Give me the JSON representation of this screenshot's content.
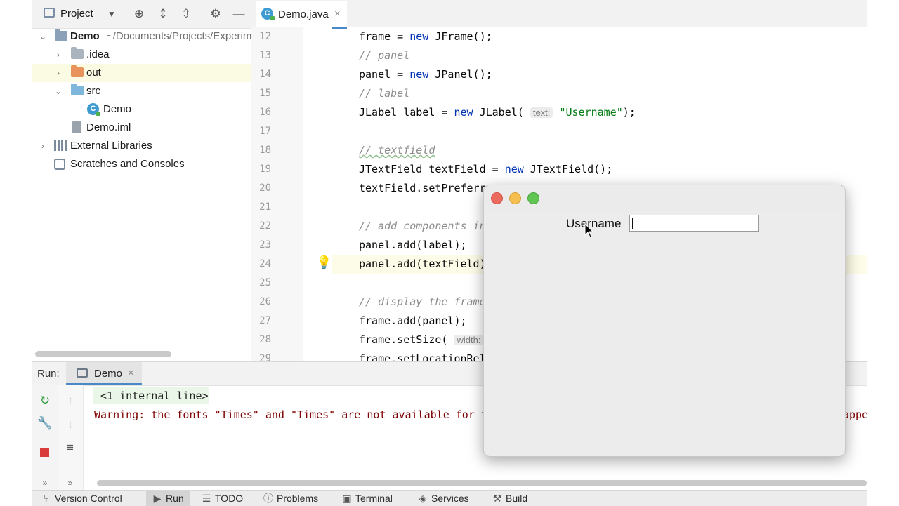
{
  "project": {
    "header_title": "Project",
    "tree": [
      {
        "name": "Demo",
        "path": "~/Documents/Projects/Experiments",
        "type": "root"
      },
      {
        "name": ".idea",
        "type": "folder"
      },
      {
        "name": "out",
        "type": "folder-excluded"
      },
      {
        "name": "src",
        "type": "folder-source"
      },
      {
        "name": "Demo",
        "type": "java-class"
      },
      {
        "name": "Demo.iml",
        "type": "file"
      },
      {
        "name": "External Libraries",
        "type": "libraries"
      },
      {
        "name": "Scratches and Consoles",
        "type": "scratches"
      }
    ]
  },
  "editor": {
    "tab_label": "Demo.java",
    "lines": [
      {
        "n": "12",
        "text": "frame = new JFrame();"
      },
      {
        "n": "13",
        "text": "// panel"
      },
      {
        "n": "14",
        "text": "panel = new JPanel();"
      },
      {
        "n": "15",
        "text": "// label"
      },
      {
        "n": "16",
        "text": "JLabel label = new JLabel( text: \"Username\");"
      },
      {
        "n": "17",
        "text": ""
      },
      {
        "n": "18",
        "text": "// textfield"
      },
      {
        "n": "19",
        "text": "JTextField textField = new JTextField();"
      },
      {
        "n": "20",
        "text": "textField.setPreferr"
      },
      {
        "n": "21",
        "text": ""
      },
      {
        "n": "22",
        "text": "// add components in"
      },
      {
        "n": "23",
        "text": "panel.add(label);"
      },
      {
        "n": "24",
        "text": "panel.add(textField)"
      },
      {
        "n": "25",
        "text": ""
      },
      {
        "n": "26",
        "text": "// display the frame"
      },
      {
        "n": "27",
        "text": "frame.add(panel);"
      },
      {
        "n": "28",
        "text": "frame.setSize( width:"
      },
      {
        "n": "29",
        "text": "frame.setLocationRel"
      }
    ],
    "hint_text": "text:",
    "hint_width": "width:",
    "label_string": "\"Username\""
  },
  "run": {
    "title": "Run:",
    "tab_label": "Demo",
    "console": [
      "<1 internal line>",
      "Warning: the fonts \"Times\" and \"Times\" are not available for t",
      "appe"
    ]
  },
  "status_bar": {
    "items": [
      "Version Control",
      "Run",
      "TODO",
      "Problems",
      "Terminal",
      "Services",
      "Build"
    ]
  },
  "swing": {
    "label": "Username",
    "field_value": ""
  },
  "colors": {
    "accent": "#4a88c7",
    "close": "#ed6a5e",
    "minimize": "#f5bf4f",
    "zoom": "#61c554",
    "warning_text": "#7f0000"
  }
}
